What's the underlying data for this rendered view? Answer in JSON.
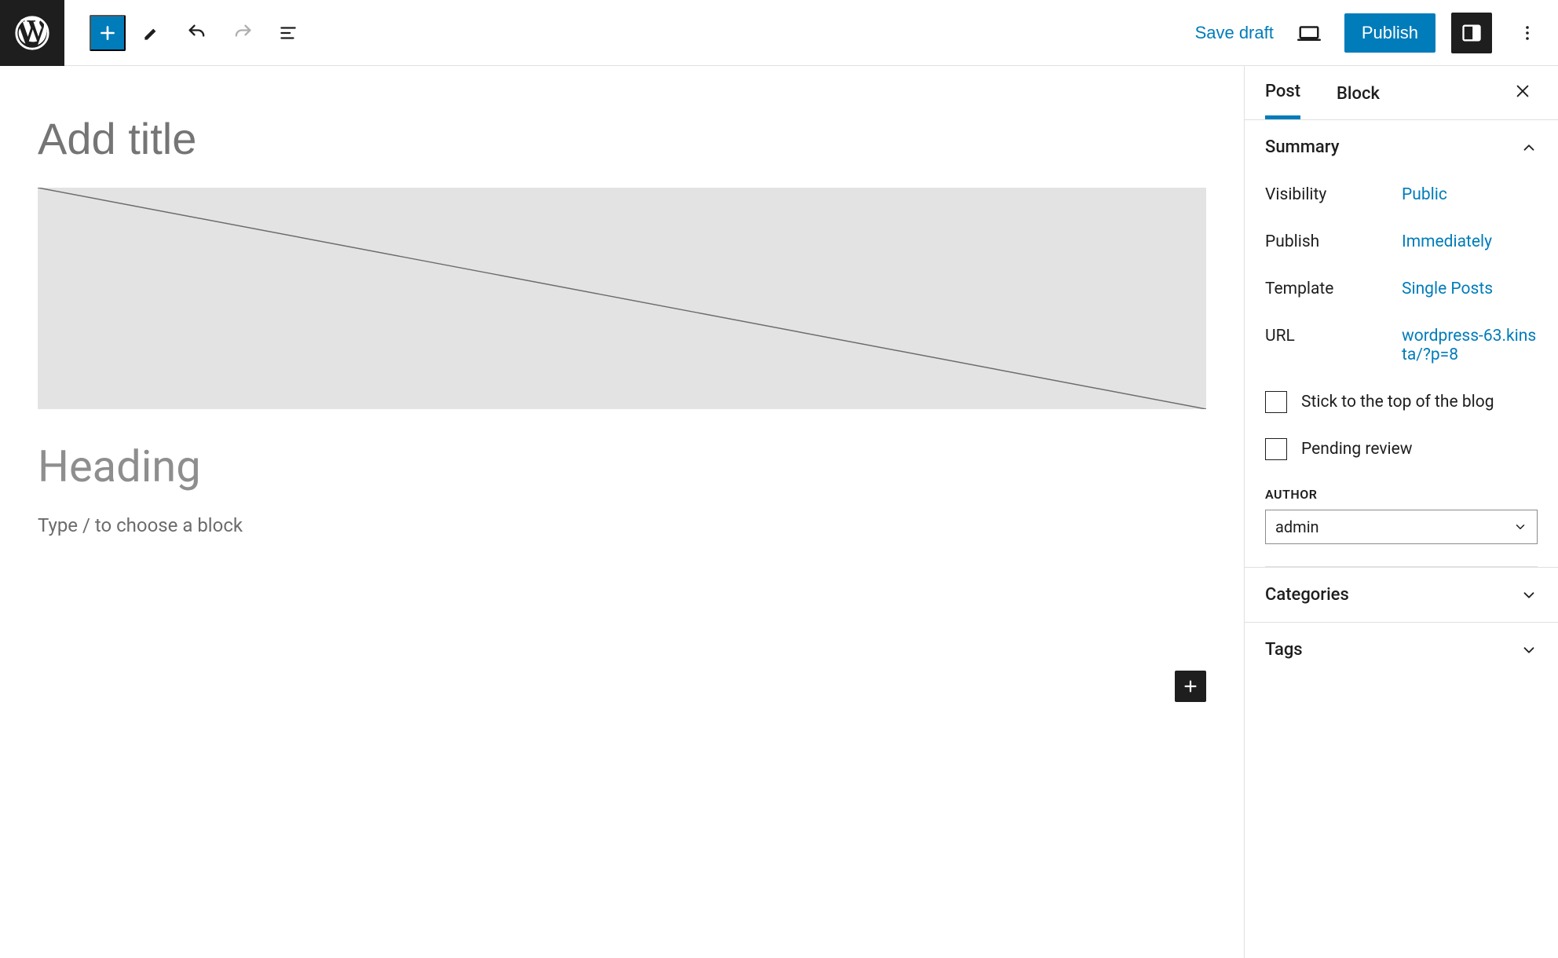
{
  "topbar": {
    "save_draft": "Save draft",
    "publish": "Publish"
  },
  "canvas": {
    "title_placeholder": "Add title",
    "heading_placeholder": "Heading",
    "paragraph_placeholder": "Type / to choose a block"
  },
  "sidebar": {
    "tabs": {
      "post": "Post",
      "block": "Block"
    },
    "summary": {
      "title": "Summary",
      "visibility_label": "Visibility",
      "visibility_value": "Public",
      "publish_label": "Publish",
      "publish_value": "Immediately",
      "template_label": "Template",
      "template_value": "Single Posts",
      "url_label": "URL",
      "url_value": "wordpress-63.kinsta/?p=8",
      "stick_label": "Stick to the top of the blog",
      "pending_label": "Pending review",
      "author_label": "AUTHOR",
      "author_value": "admin"
    },
    "categories_title": "Categories",
    "tags_title": "Tags"
  }
}
